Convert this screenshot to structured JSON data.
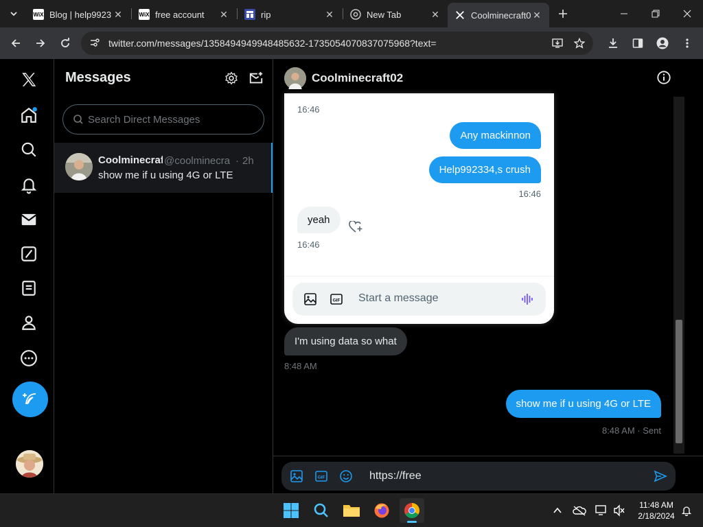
{
  "browser": {
    "tabs": [
      {
        "title": "Blog | help9923",
        "favicon": "wix-icon",
        "active": false
      },
      {
        "title": "free account",
        "favicon": "wix-icon",
        "active": false
      },
      {
        "title": "rip",
        "favicon": "app-icon",
        "active": false
      },
      {
        "title": "New Tab",
        "favicon": "chrome-icon",
        "active": false
      },
      {
        "title": "Coolminecraft0",
        "favicon": "x-icon",
        "active": true
      }
    ],
    "url": "twitter.com/messages/1358494949948485632-1735054070837075968?text="
  },
  "nav": {
    "items": [
      "x-logo",
      "home",
      "explore",
      "notifications",
      "messages",
      "grok",
      "lists",
      "profile",
      "more"
    ]
  },
  "messages_list": {
    "title": "Messages",
    "search_placeholder": "Search Direct Messages",
    "conversations": [
      {
        "name": "Coolminecraf",
        "handle": "@coolminecra",
        "time": "2h",
        "preview": "show me if u using 4G or LTE"
      }
    ]
  },
  "chat": {
    "title": "Coolminecraft02",
    "embedded_screenshot": {
      "top_time": "16:46",
      "msg_out_1": "Any mackinnon",
      "msg_out_2": "Help992334,s crush",
      "time_out": "16:46",
      "msg_in": "yeah",
      "time_in": "16:46",
      "compose_placeholder": "Start a message"
    },
    "messages": [
      {
        "direction": "in",
        "text": "I'm using data so what",
        "time": "8:48 AM"
      },
      {
        "direction": "out",
        "text": "show me if u using 4G or LTE",
        "time": "8:48 AM",
        "status": "Sent"
      }
    ],
    "compose_value": "https://free"
  },
  "taskbar": {
    "time": "11:48 AM",
    "date": "2/18/2024"
  },
  "colors": {
    "accent": "#1d9bf0",
    "background": "#000000",
    "border": "#2f3336"
  }
}
